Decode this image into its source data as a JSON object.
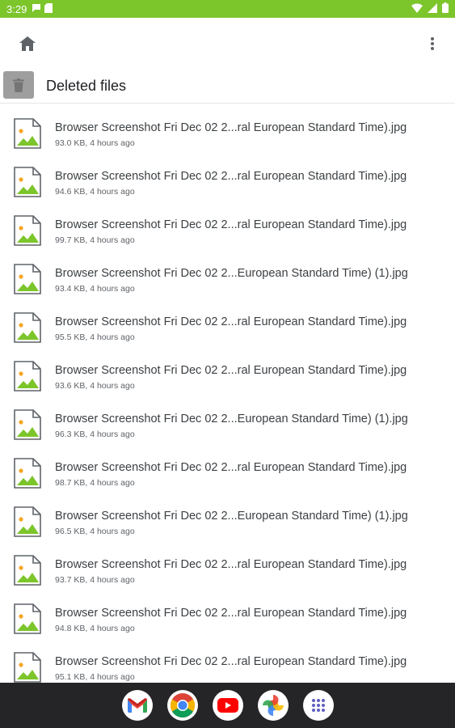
{
  "status_bar": {
    "time": "3:29"
  },
  "header": {
    "title": "Deleted files"
  },
  "files": [
    {
      "name": "Browser Screenshot Fri Dec 02 2...ral European Standard Time).jpg",
      "meta": "93.0 KB, 4 hours ago"
    },
    {
      "name": "Browser Screenshot Fri Dec 02 2...ral European Standard Time).jpg",
      "meta": "94.6 KB, 4 hours ago"
    },
    {
      "name": "Browser Screenshot Fri Dec 02 2...ral European Standard Time).jpg",
      "meta": "99.7 KB, 4 hours ago"
    },
    {
      "name": "Browser Screenshot Fri Dec 02 2...European Standard Time) (1).jpg",
      "meta": "93.4 KB, 4 hours ago"
    },
    {
      "name": "Browser Screenshot Fri Dec 02 2...ral European Standard Time).jpg",
      "meta": "95.5 KB, 4 hours ago"
    },
    {
      "name": "Browser Screenshot Fri Dec 02 2...ral European Standard Time).jpg",
      "meta": "93.6 KB, 4 hours ago"
    },
    {
      "name": "Browser Screenshot Fri Dec 02 2...European Standard Time) (1).jpg",
      "meta": "96.3 KB, 4 hours ago"
    },
    {
      "name": "Browser Screenshot Fri Dec 02 2...ral European Standard Time).jpg",
      "meta": "98.7 KB, 4 hours ago"
    },
    {
      "name": "Browser Screenshot Fri Dec 02 2...European Standard Time) (1).jpg",
      "meta": "96.5 KB, 4 hours ago"
    },
    {
      "name": "Browser Screenshot Fri Dec 02 2...ral European Standard Time).jpg",
      "meta": "93.7 KB, 4 hours ago"
    },
    {
      "name": "Browser Screenshot Fri Dec 02 2...ral European Standard Time).jpg",
      "meta": "94.8 KB, 4 hours ago"
    },
    {
      "name": "Browser Screenshot Fri Dec 02 2...ral European Standard Time).jpg",
      "meta": "95.1 KB, 4 hours ago"
    }
  ],
  "dock": [
    "gmail-icon",
    "chrome-icon",
    "youtube-icon",
    "google-photos-icon",
    "app-drawer-icon"
  ],
  "colors": {
    "status_bar": "#7cc52b",
    "nav_bar": "#252527",
    "image_icon_green": "#7cc52b",
    "image_icon_orange": "#f5a623"
  }
}
